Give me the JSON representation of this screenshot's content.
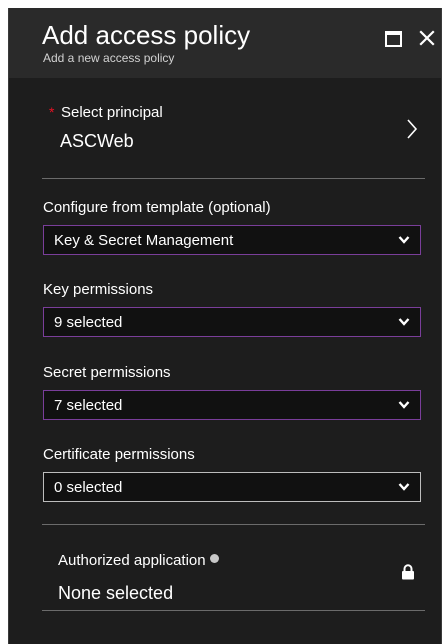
{
  "header": {
    "title": "Add access policy",
    "subtitle": "Add a new access policy"
  },
  "window_controls": [
    "maximize-icon",
    "close-icon"
  ],
  "principal": {
    "required_mark": "*",
    "label": "Select principal",
    "value": "ASCWeb",
    "icon": "chevron-right-icon"
  },
  "template": {
    "label": "Configure from template (optional)",
    "value": "Key & Secret Management"
  },
  "key_permissions": {
    "label": "Key permissions",
    "value": "9 selected"
  },
  "secret_permissions": {
    "label": "Secret permissions",
    "value": "7 selected"
  },
  "certificate_permissions": {
    "label": "Certificate permissions",
    "value": "0 selected"
  },
  "authorized_application": {
    "label": "Authorized application",
    "value": "None selected",
    "icons": [
      "info-icon",
      "lock-icon"
    ]
  },
  "colors": {
    "panel_bg": "#1d1d1d",
    "header_bg": "#2a2a2a",
    "accent_border": "#7a3e9a",
    "required": "#e81123",
    "text": "#ffffff"
  }
}
